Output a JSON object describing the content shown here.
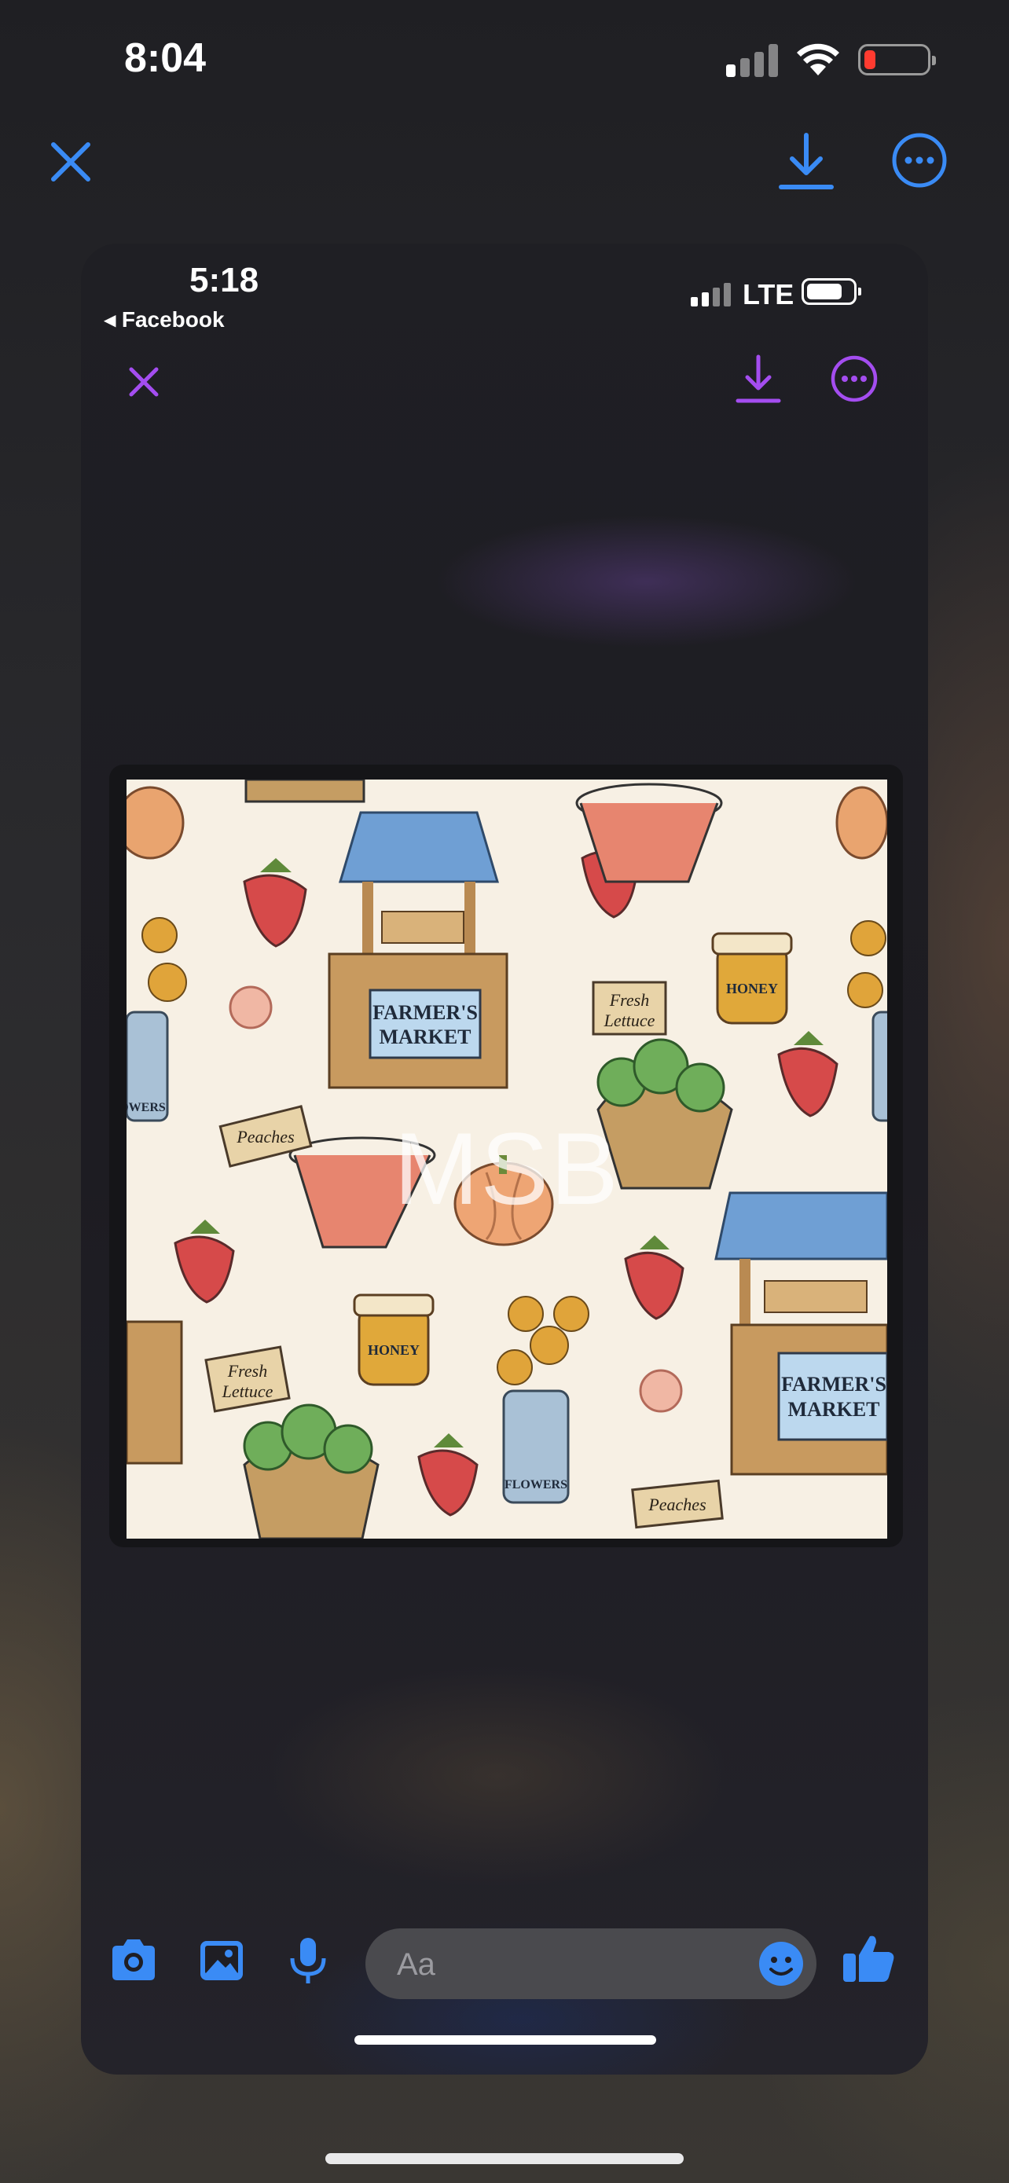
{
  "status_bar": {
    "time": "8:04",
    "battery_level": 0.15
  },
  "toolbar": {
    "close_icon": "close-icon",
    "download_icon": "download-icon",
    "more_icon": "more-icon"
  },
  "inner_screenshot": {
    "status_bar": {
      "time": "5:18",
      "back_label": "◂ Facebook",
      "network": "LTE"
    },
    "toolbar": {
      "close_icon": "close-icon",
      "download_icon": "download-icon",
      "more_icon": "more-icon"
    },
    "image": {
      "watermark": "MSB",
      "labels": {
        "market_1": [
          "FARMER'S",
          "MARKET"
        ],
        "market_2": [
          "FARMER'S",
          "MARKET"
        ],
        "honey_1": "HONEY",
        "honey_2": "HONEY",
        "lettuce_1": [
          "Fresh",
          "Lettuce"
        ],
        "lettuce_2": [
          "Fresh",
          "Lettuce"
        ],
        "peaches_1": "Peaches",
        "peaches_2": "Peaches",
        "flowers_1": "FLOWERS",
        "flowers_2": "OWERS"
      }
    },
    "composer": {
      "placeholder": "Aa",
      "icons": [
        "camera-icon",
        "photo-icon",
        "microphone-icon",
        "emoji-icon",
        "thumbs-up-icon"
      ]
    }
  },
  "colors": {
    "accent_blue": "#3a8bf5",
    "inner_accent_purple": "#a44df0",
    "battery_red": "#ff3b30"
  }
}
